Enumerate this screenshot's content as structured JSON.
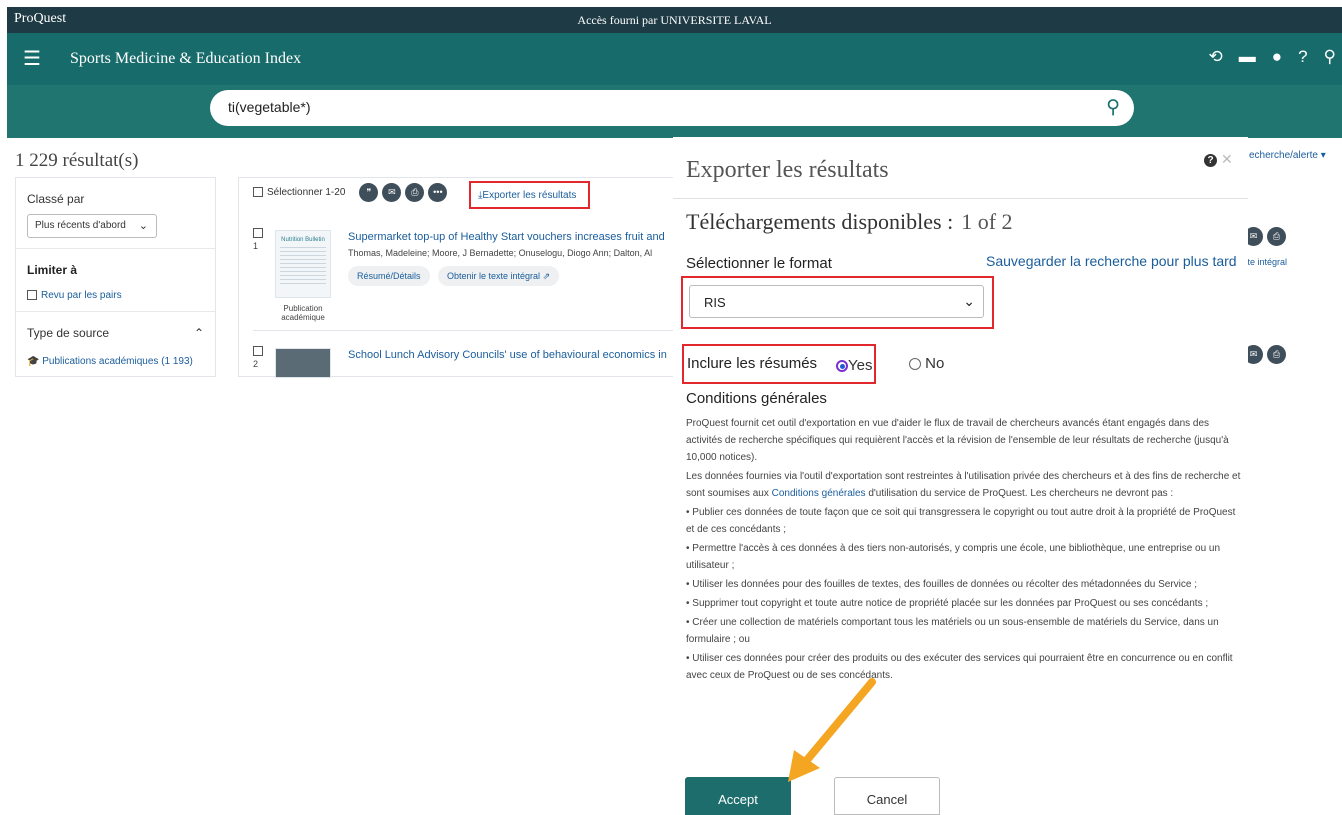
{
  "topbar": {
    "brand": "ProQuest",
    "access": "Accès fourni par UNIVERSITE LAVAL"
  },
  "navbar": {
    "title": "Sports Medicine & Education Index",
    "icons": [
      "history-icon",
      "folder-icon",
      "user-icon",
      "help-icon",
      "search-icon"
    ]
  },
  "search": {
    "query": "ti(vegetable*)"
  },
  "results": {
    "count": "1 229 résultat(s)"
  },
  "left": {
    "sort_label": "Classé par",
    "sort_value": "Plus récents d'abord",
    "limit_label": "Limiter à",
    "peer_reviewed": "Revu par les pairs",
    "source_type": "Type de source",
    "academic_pubs": "Publications académiques (1 193)"
  },
  "toolbar": {
    "select_label": "Sélectionner 1-20",
    "export_label": "Exporter les résultats"
  },
  "items": [
    {
      "num": "1",
      "title": "Supermarket top-up of Healthy Start vouchers increases fruit and",
      "authors": "Thomas, Madeleine; Moore, J Bernadette; Onuselogu, Diogo Ann; Dalton, Al",
      "summary": "Résumé/Détails",
      "fulltext": "Obtenir le texte intégral",
      "thumb_title": "Nutrition Bulletin",
      "thumb_caption": "Publication académique"
    },
    {
      "num": "2",
      "title": "School Lunch Advisory Councils' use of behavioural economics in"
    }
  ],
  "side": {
    "save_alert": "echerche/alerte ▾",
    "fulltext": "xte intégral"
  },
  "modal": {
    "title": "Exporter les résultats",
    "downloads_label": "Téléchargements disponibles :",
    "downloads_count": "1 of 2",
    "format_label": "Sélectionner le format",
    "save_link": "Sauvegarder la recherche pour plus tard",
    "format_value": "RIS",
    "include_label": "Inclure les résumés",
    "yes": "Yes",
    "no": "No",
    "conditions_title": "Conditions générales",
    "p1": "ProQuest fournit cet outil d'exportation en vue d'aider le flux de travail de chercheurs avancés étant engagés dans des activités de recherche spécifiques qui requièrent l'accès et la révision de l'ensemble de leur résultats de recherche (jusqu'à 10,000 notices).",
    "p2a": "Les données fournies via l'outil d'exportation sont restreintes à l'utilisation privée des chercheurs et à des fins de recherche et sont soumises aux ",
    "p2link": "Conditions générales",
    "p2b": " d'utilisation du service de ProQuest. Les chercheurs ne devront pas :",
    "b1": "• Publier ces données de toute façon que ce soit qui transgressera le copyright ou tout autre droit à la propriété de ProQuest et de ces concédants ;",
    "b2": "• Permettre l'accès à ces données à des tiers non-autorisés, y compris une école, une bibliothèque, une entreprise ou un utilisateur ;",
    "b3": "• Utiliser les données pour des fouilles de textes, des fouilles de données ou récolter des métadonnées du Service ;",
    "b4": "• Supprimer tout copyright et toute autre notice de propriété placée sur les données par ProQuest ou ses concédants ;",
    "b5": "• Créer une collection de matériels comportant tous les matériels ou un sous-ensemble de matériels du Service, dans un formulaire ; ou",
    "b6": "• Utiliser ces données pour créer des produits ou des exécuter des services qui pourraient être en concurrence ou en conflit avec ceux de ProQuest ou de ses concédants.",
    "accept": "Accept",
    "cancel": "Cancel"
  },
  "colors": {
    "header_dark": "#1e3a45",
    "teal": "#186b6b",
    "search_band": "#207571",
    "accept": "#1e6d6d",
    "highlight_red": "#e2282c",
    "arrow": "#f4a623",
    "link": "#1a5d9c"
  }
}
